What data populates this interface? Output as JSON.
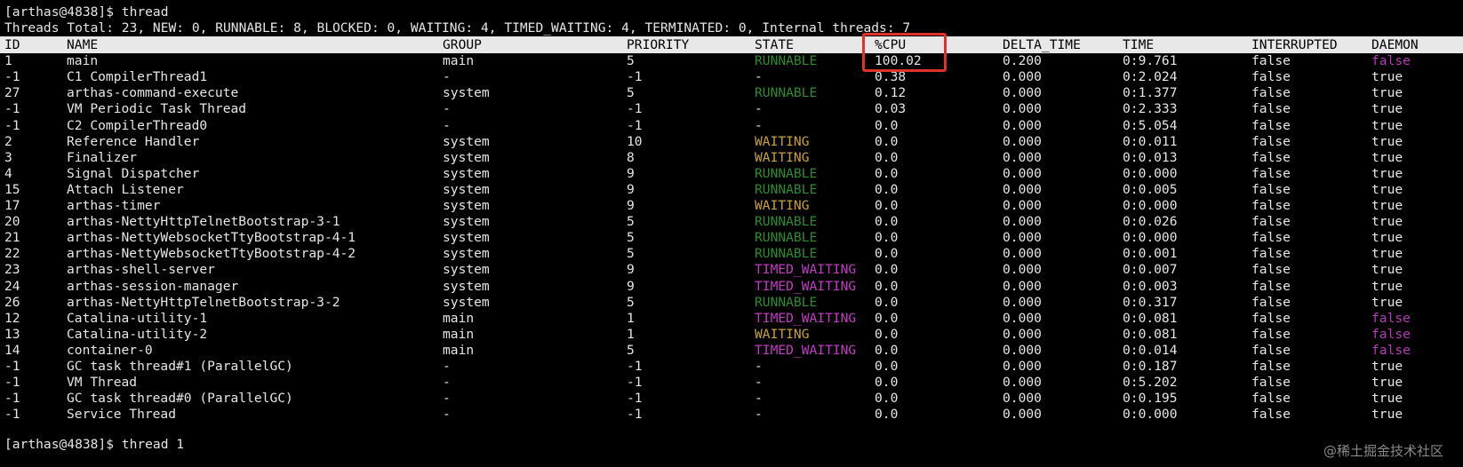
{
  "colors": {
    "background": "#000000",
    "text": "#e6e6e6",
    "header_bg": "#e8e8e8",
    "header_text": "#000000",
    "runnable": "#2e8b2e",
    "waiting": "#c8a13a",
    "timed_waiting": "#c23cc2",
    "daemon_false": "#b43cb4",
    "highlight_border": "#e0322b"
  },
  "terminal": {
    "command_line": "[arthas@4838]$ thread",
    "summary_line": "Threads Total: 23, NEW: 0, RUNNABLE: 8, BLOCKED: 0, WAITING: 4, TIMED_WAITING: 4, TERMINATED: 0, Internal threads: 7",
    "next_prompt": "[arthas@4838]$ thread 1"
  },
  "table": {
    "columns": [
      "ID",
      "NAME",
      "GROUP",
      "PRIORITY",
      "STATE",
      "%CPU",
      "DELTA_TIME",
      "TIME",
      "INTERRUPTED",
      "DAEMON"
    ],
    "rows": [
      [
        "1",
        "main",
        "main",
        "5",
        "RUNNABLE",
        "100.02",
        "0.200",
        "0:9.761",
        "false",
        "false"
      ],
      [
        "-1",
        "C1 CompilerThread1",
        "-",
        "-1",
        "-",
        "0.38",
        "0.000",
        "0:2.024",
        "false",
        "true"
      ],
      [
        "27",
        "arthas-command-execute",
        "system",
        "5",
        "RUNNABLE",
        "0.12",
        "0.000",
        "0:1.377",
        "false",
        "true"
      ],
      [
        "-1",
        "VM Periodic Task Thread",
        "-",
        "-1",
        "-",
        "0.03",
        "0.000",
        "0:2.333",
        "false",
        "true"
      ],
      [
        "-1",
        "C2 CompilerThread0",
        "-",
        "-1",
        "-",
        "0.0",
        "0.000",
        "0:5.054",
        "false",
        "true"
      ],
      [
        "2",
        "Reference Handler",
        "system",
        "10",
        "WAITING",
        "0.0",
        "0.000",
        "0:0.011",
        "false",
        "true"
      ],
      [
        "3",
        "Finalizer",
        "system",
        "8",
        "WAITING",
        "0.0",
        "0.000",
        "0:0.013",
        "false",
        "true"
      ],
      [
        "4",
        "Signal Dispatcher",
        "system",
        "9",
        "RUNNABLE",
        "0.0",
        "0.000",
        "0:0.000",
        "false",
        "true"
      ],
      [
        "15",
        "Attach Listener",
        "system",
        "9",
        "RUNNABLE",
        "0.0",
        "0.000",
        "0:0.005",
        "false",
        "true"
      ],
      [
        "17",
        "arthas-timer",
        "system",
        "9",
        "WAITING",
        "0.0",
        "0.000",
        "0:0.000",
        "false",
        "true"
      ],
      [
        "20",
        "arthas-NettyHttpTelnetBootstrap-3-1",
        "system",
        "5",
        "RUNNABLE",
        "0.0",
        "0.000",
        "0:0.026",
        "false",
        "true"
      ],
      [
        "21",
        "arthas-NettyWebsocketTtyBootstrap-4-1",
        "system",
        "5",
        "RUNNABLE",
        "0.0",
        "0.000",
        "0:0.000",
        "false",
        "true"
      ],
      [
        "22",
        "arthas-NettyWebsocketTtyBootstrap-4-2",
        "system",
        "5",
        "RUNNABLE",
        "0.0",
        "0.000",
        "0:0.001",
        "false",
        "true"
      ],
      [
        "23",
        "arthas-shell-server",
        "system",
        "9",
        "TIMED_WAITING",
        "0.0",
        "0.000",
        "0:0.007",
        "false",
        "true"
      ],
      [
        "24",
        "arthas-session-manager",
        "system",
        "9",
        "TIMED_WAITING",
        "0.0",
        "0.000",
        "0:0.003",
        "false",
        "true"
      ],
      [
        "26",
        "arthas-NettyHttpTelnetBootstrap-3-2",
        "system",
        "5",
        "RUNNABLE",
        "0.0",
        "0.000",
        "0:0.317",
        "false",
        "true"
      ],
      [
        "12",
        "Catalina-utility-1",
        "main",
        "1",
        "TIMED_WAITING",
        "0.0",
        "0.000",
        "0:0.081",
        "false",
        "false"
      ],
      [
        "13",
        "Catalina-utility-2",
        "main",
        "1",
        "WAITING",
        "0.0",
        "0.000",
        "0:0.081",
        "false",
        "false"
      ],
      [
        "14",
        "container-0",
        "main",
        "5",
        "TIMED_WAITING",
        "0.0",
        "0.000",
        "0:0.014",
        "false",
        "false"
      ],
      [
        "-1",
        "GC task thread#1 (ParallelGC)",
        "-",
        "-1",
        "-",
        "0.0",
        "0.000",
        "0:0.187",
        "false",
        "true"
      ],
      [
        "-1",
        "VM Thread",
        "-",
        "-1",
        "-",
        "0.0",
        "0.000",
        "0:5.202",
        "false",
        "true"
      ],
      [
        "-1",
        "GC task thread#0 (ParallelGC)",
        "-",
        "-1",
        "-",
        "0.0",
        "0.000",
        "0:0.195",
        "false",
        "true"
      ],
      [
        "-1",
        "Service Thread",
        "-",
        "-1",
        "-",
        "0.0",
        "0.000",
        "0:0.000",
        "false",
        "true"
      ]
    ]
  },
  "watermark": "@稀土掘金技术社区"
}
